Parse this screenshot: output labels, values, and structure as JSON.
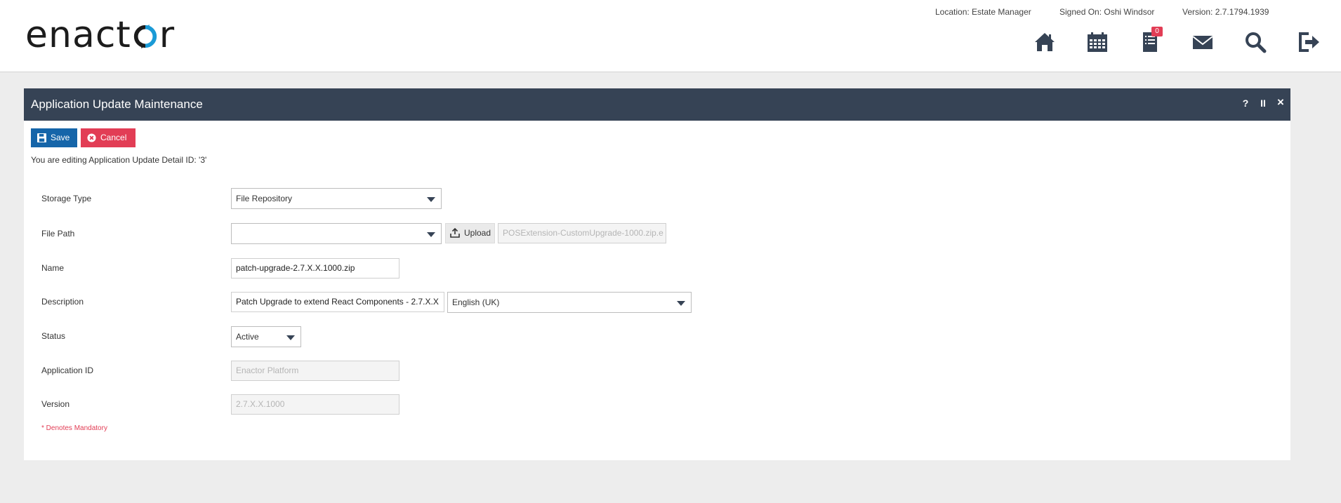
{
  "brand": {
    "logo_text": "enactor"
  },
  "header": {
    "location": "Location: Estate Manager",
    "signed_on": "Signed On: Oshi Windsor",
    "version": "Version: 2.7.1794.1939",
    "icons": [
      "home-icon",
      "calendar-icon",
      "document-icon",
      "mail-icon",
      "search-icon",
      "logout-icon"
    ],
    "document_badge": "0"
  },
  "panel": {
    "title": "Application Update Maintenance",
    "help": "?",
    "pause": "II",
    "close": "×",
    "save_label": "Save",
    "cancel_label": "Cancel",
    "editing_message": "You are editing Application Update Detail ID: '3'"
  },
  "form": {
    "storage_type": {
      "label": "Storage Type",
      "value": "File Repository"
    },
    "file_path": {
      "label": "File Path",
      "value": "",
      "upload_label": "Upload",
      "uploaded_file": "POSExtension-CustomUpgrade-1000.zip.e"
    },
    "name": {
      "label": "Name",
      "value": "patch-upgrade-2.7.X.X.1000.zip"
    },
    "description": {
      "label": "Description",
      "value": "Patch Upgrade to extend React Components - 2.7.X.X",
      "language": "English (UK)"
    },
    "status": {
      "label": "Status",
      "value": "Active"
    },
    "application_id": {
      "label": "Application ID",
      "value": "Enactor Platform"
    },
    "version": {
      "label": "Version",
      "value": "2.7.X.X.1000"
    },
    "mandatory_note": "* Denotes Mandatory"
  },
  "colors": {
    "titlebar": "#364355",
    "save": "#1565a9",
    "cancel": "#e23d55",
    "accent_logo": "#1a9ad6"
  }
}
